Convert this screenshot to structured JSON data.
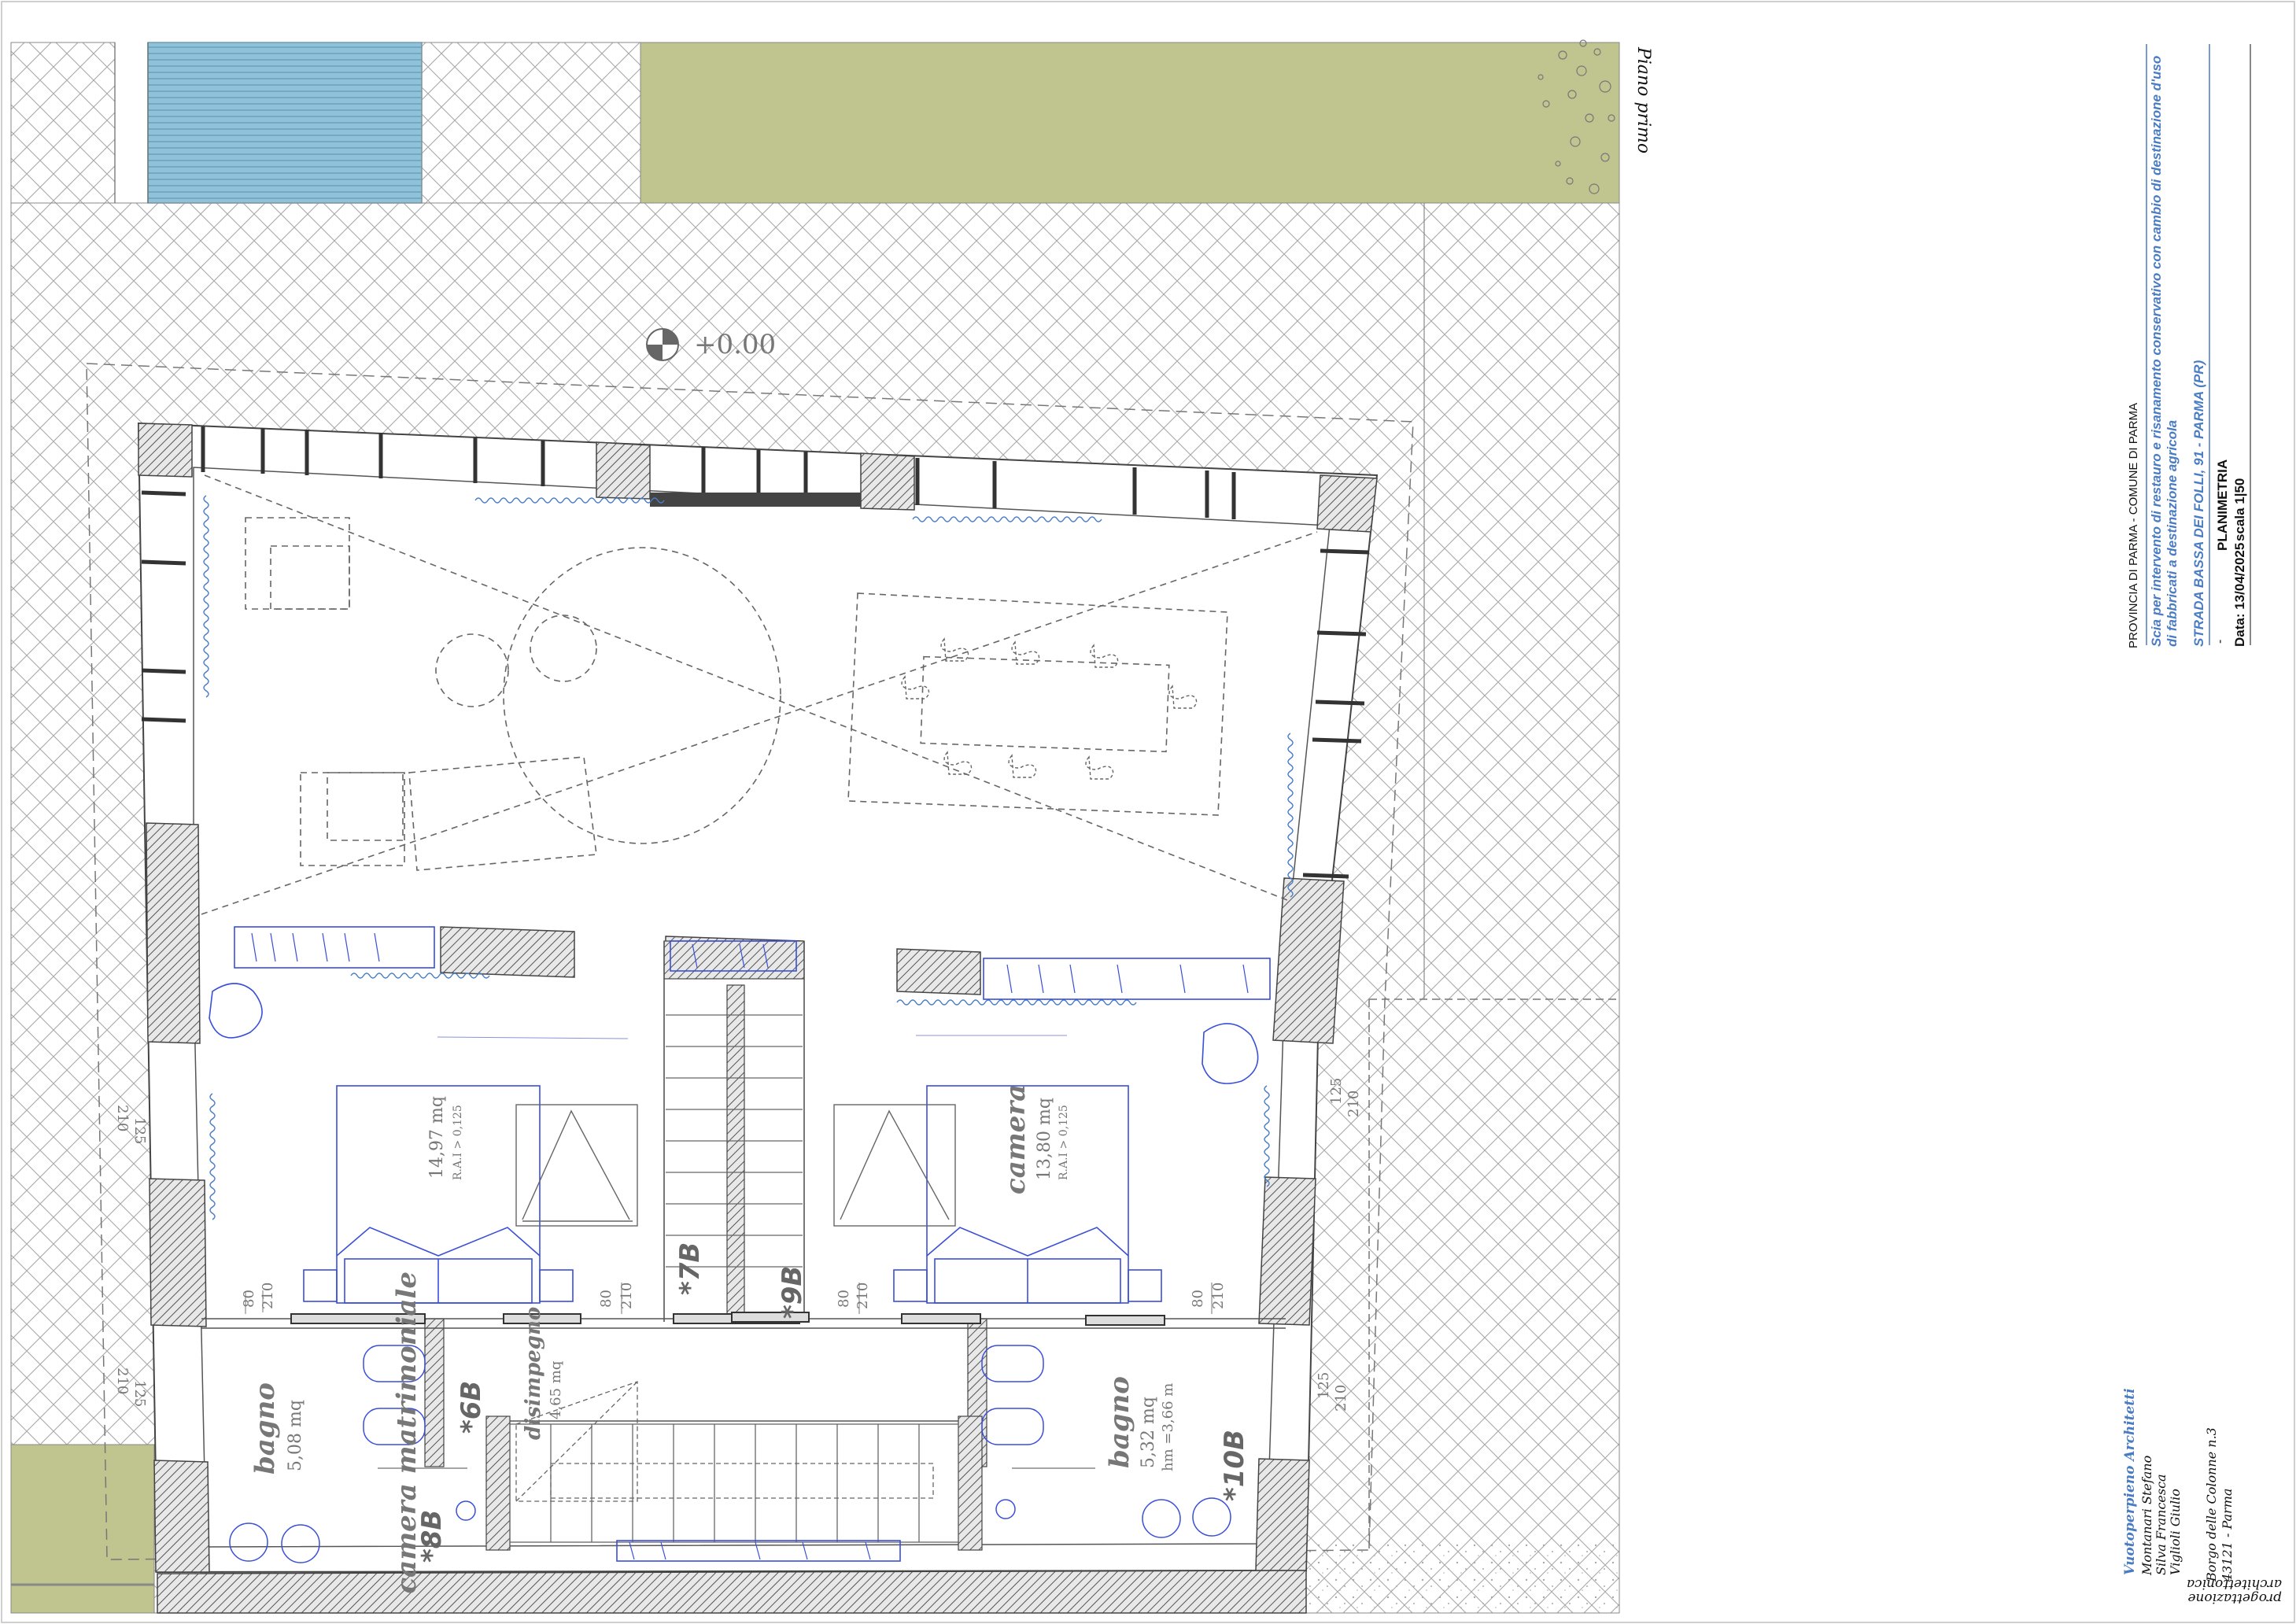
{
  "sheet": {
    "floor_label": "Piano primo",
    "elevation": "+0.00"
  },
  "rooms": [
    {
      "name": "camera matrimoniale",
      "area": "14,97 mq",
      "ratio": "R.A.I > 0,125"
    },
    {
      "name": "camera",
      "area": "13,80 mq",
      "ratio": "R.A.I > 0,125"
    },
    {
      "name": "bagno",
      "area": "5,08 mq"
    },
    {
      "name": "bagno",
      "area": "5,32 mq",
      "height": "hm =3,66 m"
    },
    {
      "name": "disimpegno",
      "area": "4,65 mq"
    }
  ],
  "markers": [
    "*6B",
    "*7B",
    "*8B",
    "*9B",
    "*10B"
  ],
  "door_dims": {
    "width": "80",
    "height": "210"
  },
  "window_dims": {
    "sill": "125",
    "height": "210"
  },
  "title_block": {
    "authority": "PROVINCIA DI PARMA - COMUNE DI PARMA",
    "project_line1": "Scia per intervento di restauro e risanamento conservativo con cambio di destinazione d'uso",
    "project_line2": "di fabbricati a destinazione agricola",
    "address": "STRADA BASSA DEI FOLLI, 91 - PARMA (PR)",
    "drawing_title": "PLANIMETRIA",
    "date": "Data: 13/04/2025",
    "scale": "scala 1|50",
    "dash": "-"
  },
  "studio": {
    "name": "Vuotoperpieno Architetti",
    "members": [
      "Montanari Stefano",
      "Silva Francesca",
      "Viglioli Giulio"
    ],
    "street": "Borgo delle Colonne n.3",
    "city": "43121 - Parma",
    "tagline_1": "progettazione",
    "tagline_2": "architettonica"
  },
  "colors": {
    "pool": "#8fc2d8",
    "lawn": "#c0c48e",
    "accent_blue": "#4a7cc4",
    "furniture_blue": "#3a4fd8",
    "wall_hatch": "#555555",
    "pattern": "#9a9a9a"
  }
}
